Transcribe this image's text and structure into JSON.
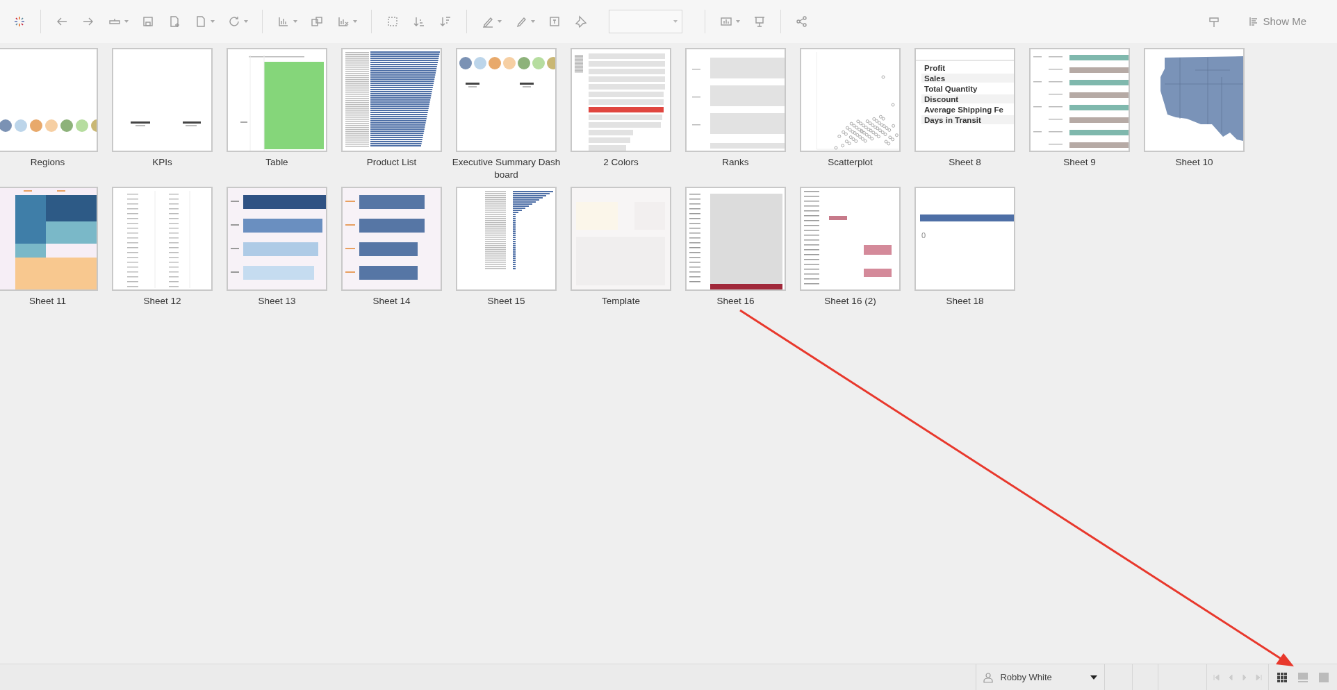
{
  "toolbar": {
    "show_me": "Show Me"
  },
  "sheets": [
    {
      "name": "Regions",
      "kind": "circles"
    },
    {
      "name": "KPIs",
      "kind": "kpi"
    },
    {
      "name": "Table",
      "kind": "green-table"
    },
    {
      "name": "Product List",
      "kind": "long-bars"
    },
    {
      "name": "Executive Summary Dashboard",
      "kind": "summary"
    },
    {
      "name": "2 Colors",
      "kind": "gray-red-bars"
    },
    {
      "name": "Ranks",
      "kind": "ranks"
    },
    {
      "name": "Scatterplot",
      "kind": "scatter"
    },
    {
      "name": "Sheet 8",
      "kind": "text-list",
      "lines": [
        "Profit",
        "Sales",
        "Total Quantity",
        "Discount",
        "Average Shipping Fe",
        "Days in Transit"
      ]
    },
    {
      "name": "Sheet 9",
      "kind": "paired-bars"
    },
    {
      "name": "Sheet 10",
      "kind": "map"
    },
    {
      "name": "Sheet 11",
      "kind": "heatmap"
    },
    {
      "name": "Sheet 12",
      "kind": "text-table"
    },
    {
      "name": "Sheet 13",
      "kind": "shaded-bars"
    },
    {
      "name": "Sheet 14",
      "kind": "labeled-bars"
    },
    {
      "name": "Sheet 15",
      "kind": "thin-bars"
    },
    {
      "name": "Template",
      "kind": "template"
    },
    {
      "name": "Sheet 16",
      "kind": "highlight-table"
    },
    {
      "name": "Sheet 16 (2)",
      "kind": "pink-table"
    },
    {
      "name": "Sheet 18",
      "kind": "single-bar",
      "axis_label": "0"
    }
  ],
  "status_bar": {
    "user": "Robby White",
    "views": [
      {
        "kind": "grid",
        "selected": true
      },
      {
        "kind": "list",
        "selected": false
      },
      {
        "kind": "film",
        "selected": false
      }
    ]
  }
}
